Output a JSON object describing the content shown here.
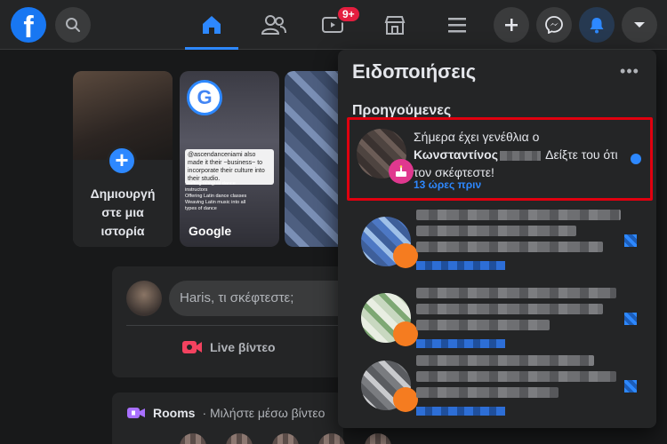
{
  "topbar": {
    "logo": "f",
    "icons": {
      "search": "search-icon",
      "home": "home-icon",
      "friends": "friends-icon",
      "watch": "video-icon",
      "marketplace": "store-icon",
      "menu": "menu-icon",
      "create": "plus-icon",
      "messenger": "messenger-icon",
      "notifications": "bell-icon",
      "account": "chevron-down-icon"
    },
    "watch_badge": "9+",
    "accent_color": "#2d88ff"
  },
  "stories": {
    "create_label": "Δημιουργή στε μια ιστορία",
    "create_line1": "Δημιουργή",
    "create_line2": "στε μια",
    "create_line3": "ιστορία",
    "google_name": "Google",
    "google_logo": "G",
    "google_caption": "@ascendanceniami also made it their ~business~ to incorporate their culture into their studio.",
    "google_bullets": [
      "Staffing bilingual dance instructors",
      "Offering Latin dance classes",
      "Weaving Latin music into all types of dance"
    ]
  },
  "composer": {
    "placeholder": "Haris, τι σκέφτεστε;",
    "live_label": "Live βίντεο"
  },
  "rooms": {
    "title": "Rooms",
    "subtitle": " · Μιλήστε μέσω βίντεο"
  },
  "notifications": {
    "title": "Ειδοποιήσεις",
    "more": "•••",
    "section_label": "Προηγούμενες",
    "items": [
      {
        "text_before": "Σήμερα έχει γενέθλια ο ",
        "name": "Κωνσταντίνος",
        "text_after": " Δείξτε του ότι τον σκέφτεστε!",
        "time": "13 ώρες πριν",
        "icon": "birthday-cake-icon",
        "unread": true
      }
    ]
  }
}
